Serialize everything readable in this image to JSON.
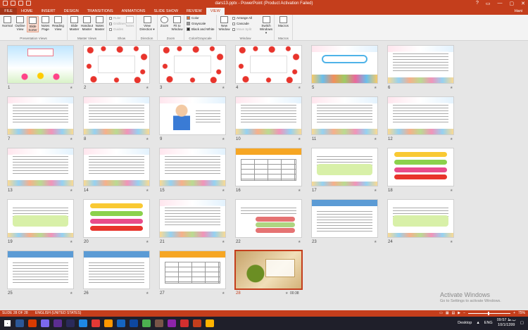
{
  "window": {
    "title": "dars13.pptx - PowerPoint (Product Activation Failed)",
    "controls": [
      "?",
      "▭",
      "—",
      "▢",
      "✕"
    ]
  },
  "tabs": {
    "file": "FILE",
    "items": [
      "HOME",
      "INSERT",
      "DESIGN",
      "TRANSITIONS",
      "ANIMATIONS",
      "SLIDE SHOW",
      "REVIEW",
      "VIEW"
    ],
    "active": "VIEW",
    "user": "Hani"
  },
  "ribbon": {
    "groups": {
      "presentation_views": {
        "label": "Presentation Views",
        "buttons": [
          {
            "label": "Normal",
            "selected": false
          },
          {
            "label": "Outline View",
            "selected": false
          },
          {
            "label": "Slide Sorter",
            "selected": true
          },
          {
            "label": "Notes Page",
            "selected": false
          },
          {
            "label": "Reading View",
            "selected": false
          }
        ]
      },
      "master_views": {
        "label": "Master Views",
        "buttons": [
          "Slide Master",
          "Handout Master",
          "Notes Master"
        ]
      },
      "show": {
        "label": "Show",
        "items": [
          "Ruler",
          "Gridlines",
          "Guides"
        ],
        "notes_button": "Notes"
      },
      "direction": {
        "label": "Direction",
        "button": "View Direction ▾"
      },
      "zoom": {
        "label": "Zoom",
        "buttons": [
          "Zoom",
          "Fit to Window"
        ]
      },
      "color": {
        "label": "Color/Grayscale",
        "items": [
          {
            "label": "Color",
            "swatch": "#e0703a"
          },
          {
            "label": "Grayscale",
            "swatch": "#9a9a9a"
          },
          {
            "label": "Black and White",
            "swatch": "#222222"
          }
        ]
      },
      "window": {
        "label": "Window",
        "new_window": "New Window",
        "items": [
          "Arrange All",
          "Cascade",
          "Move Split"
        ],
        "switch": "Switch Windows ▾"
      },
      "macros": {
        "label": "Macros",
        "button": "Macros"
      }
    }
  },
  "slides": [
    {
      "num": "1",
      "kind": "cover"
    },
    {
      "num": "2",
      "kind": "flowers"
    },
    {
      "num": "3",
      "kind": "flowers"
    },
    {
      "num": "4",
      "kind": "flowers"
    },
    {
      "num": "5",
      "kind": "title-rainbow"
    },
    {
      "num": "6",
      "kind": "text-rainbow"
    },
    {
      "num": "7",
      "kind": "text-rainbow"
    },
    {
      "num": "8",
      "kind": "text-rainbow"
    },
    {
      "num": "9",
      "kind": "boy"
    },
    {
      "num": "10",
      "kind": "text-rainbow"
    },
    {
      "num": "11",
      "kind": "text-rainbow"
    },
    {
      "num": "12",
      "kind": "text-rainbow"
    },
    {
      "num": "13",
      "kind": "text-rainbow"
    },
    {
      "num": "14",
      "kind": "text-rainbow"
    },
    {
      "num": "15",
      "kind": "text-rainbow"
    },
    {
      "num": "16",
      "kind": "table"
    },
    {
      "num": "17",
      "kind": "banner"
    },
    {
      "num": "18",
      "kind": "pills"
    },
    {
      "num": "19",
      "kind": "banner"
    },
    {
      "num": "20",
      "kind": "pills"
    },
    {
      "num": "21",
      "kind": "text-rainbow"
    },
    {
      "num": "22",
      "kind": "bars"
    },
    {
      "num": "23",
      "kind": "doc"
    },
    {
      "num": "24",
      "kind": "banner"
    },
    {
      "num": "25",
      "kind": "doc"
    },
    {
      "num": "26",
      "kind": "doc"
    },
    {
      "num": "27",
      "kind": "table"
    },
    {
      "num": "28",
      "kind": "bronze",
      "selected": true,
      "time": "00:38"
    }
  ],
  "watermark": {
    "line1": "Activate Windows",
    "line2": "Go to Settings to activate Windows."
  },
  "status": {
    "slide_info": "SLIDE 28 OF 28",
    "language": "ENGLISH (UNITED STATES)",
    "zoom": "75%"
  },
  "taskbar": {
    "desktop": "Desktop",
    "lang": "ENG",
    "time": "09:57 ب.ظ",
    "date": "10/1/1399"
  }
}
